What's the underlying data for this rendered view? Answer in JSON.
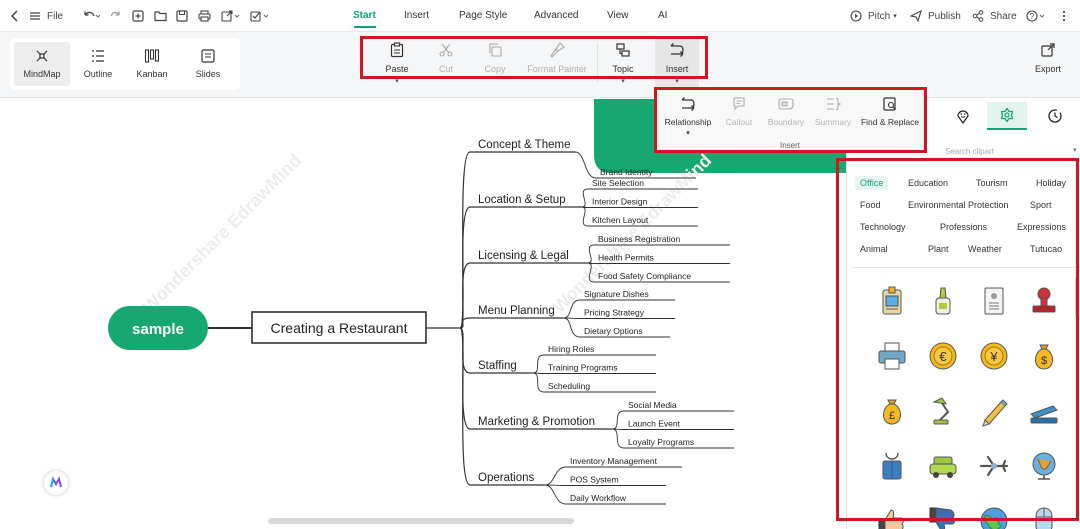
{
  "menu": {
    "file_label": "File",
    "tabs": [
      {
        "label": "Start",
        "active": true
      },
      {
        "label": "Insert"
      },
      {
        "label": "Page Style"
      },
      {
        "label": "Advanced"
      },
      {
        "label": "View"
      },
      {
        "label": "AI"
      }
    ],
    "pitch_label": "Pitch",
    "publish_label": "Publish",
    "share_label": "Share"
  },
  "views": [
    {
      "label": "MindMap",
      "active": true,
      "icon": "mindmap-icon"
    },
    {
      "label": "Outline",
      "icon": "outline-icon"
    },
    {
      "label": "Kanban",
      "icon": "kanban-icon"
    },
    {
      "label": "Slides",
      "icon": "slides-icon"
    }
  ],
  "ribbon": {
    "paste": "Paste",
    "cut": "Cut",
    "copy": "Copy",
    "format_painter": "Format Painter",
    "topic": "Topic",
    "insert": "Insert",
    "export": "Export"
  },
  "insert_popup": {
    "relationship": "Relationship",
    "callout": "Callout",
    "boundary": "Boundary",
    "summary": "Summary",
    "find_replace": "Find & Replace",
    "caption": "Insert"
  },
  "mindmap": {
    "floating_topic": "sample",
    "central_topic": "Creating a Restaurant",
    "watermark": "Wondershare EdrawMind",
    "branches": [
      {
        "label": "Concept & Theme",
        "children": [
          "Brand Identity"
        ]
      },
      {
        "label": "Location & Setup",
        "children": [
          "Site Selection",
          "Interior Design",
          "Kitchen Layout"
        ]
      },
      {
        "label": "Licensing & Legal",
        "children": [
          "Business Registration",
          "Health Permits",
          "Food Safety Compliance"
        ]
      },
      {
        "label": "Menu Planning",
        "children": [
          "Signature Dishes",
          "Pricing Strategy",
          "Dietary Options"
        ]
      },
      {
        "label": "Staffing",
        "children": [
          "Hiring Roles",
          "Training Programs",
          "Scheduling"
        ]
      },
      {
        "label": "Marketing & Promotion",
        "children": [
          "Social Media",
          "Launch Event",
          "Loyalty Programs"
        ]
      },
      {
        "label": "Operations",
        "children": [
          "Inventory Management",
          "POS System",
          "Daily Workflow"
        ]
      }
    ]
  },
  "panel": {
    "search_placeholder": "Search clipart",
    "categories": [
      [
        "Office",
        "Education",
        "Tourism",
        "Holiday"
      ],
      [
        "Food",
        "Environmental Protection",
        "Sport"
      ],
      [
        "Technology",
        "Professions",
        "Expressions"
      ],
      [
        "Animal",
        "Plant",
        "Weather",
        "Tutucao"
      ]
    ],
    "active_category": "Office",
    "icons": [
      "id-badge-icon",
      "glue-bottle-icon",
      "id-card-icon",
      "rubber-stamp-icon",
      "printer-icon",
      "euro-coin-icon",
      "yen-coin-icon",
      "dollar-bag-icon",
      "pound-bag-icon",
      "desk-lamp-icon",
      "pencil-icon",
      "stapler-icon",
      "binder-clip-icon",
      "taxi-icon",
      "airplane-icon",
      "globe-icon",
      "thumbs-up-icon",
      "thumbs-down-icon",
      "earth-icon",
      "mouse-icon"
    ]
  },
  "colors": {
    "accent": "#0da66e",
    "highlight_box": "#d0161f",
    "branch_line": "#333333"
  }
}
